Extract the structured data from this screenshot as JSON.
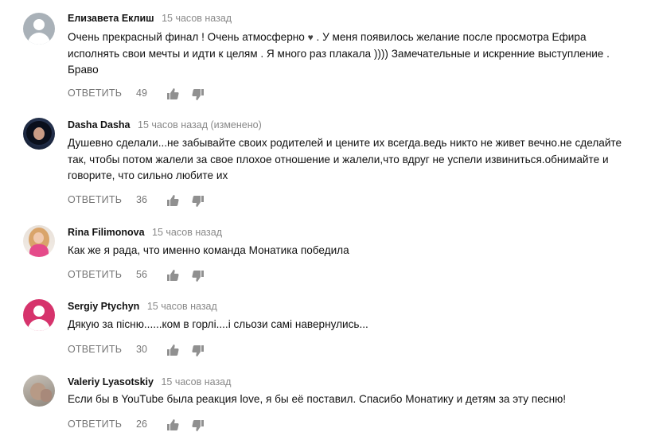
{
  "comments": [
    {
      "author": "Елизавета Еклиш",
      "time": "15 часов назад",
      "text_part1": "Очень прекрасный финал ! Очень атмосферно ",
      "emoji": "♥︎",
      "text_part2": " . У меня появилось желание после просмотра Ефира исполнять свои мечты и идти к целям . Я много раз плакала )))) Замечательные и искренние выступление . Браво",
      "likes": "49",
      "reply_label": "ОТВЕТИТЬ",
      "avatar": "default-avatar-grey"
    },
    {
      "author": "Dasha Dasha",
      "time": "15 часов назад (изменено)",
      "text": "Душевно сделали...не забывайте своих родителей и цените их всегда.ведь никто не живет вечно.не сделайте так, чтобы потом жалели за свое плохое отношение и жалели,что вдруг не успели извиниться.обнимайте и говорите, что сильно любите их",
      "likes": "36",
      "reply_label": "ОТВЕТИТЬ",
      "avatar": "photo"
    },
    {
      "author": "Rina Filimonova",
      "time": "15 часов назад",
      "text": "Как же я рада, что именно команда Монатика победила",
      "likes": "56",
      "reply_label": "ОТВЕТИТЬ",
      "avatar": "photo"
    },
    {
      "author": "Sergiy Ptychyn",
      "time": "15 часов назад",
      "text": "Дякую за пісню......ком в горлі....і сльози самі навернулись...",
      "likes": "30",
      "reply_label": "ОТВЕТИТЬ",
      "avatar": "default-avatar-pink"
    },
    {
      "author": "Valeriy Lyasotskiy",
      "time": "15 часов назад",
      "text": "Если бы в YouTube была реакция love, я бы её поставил. Спасибо Монатику и детям за эту песню!",
      "likes": "26",
      "reply_label": "ОТВЕТИТЬ",
      "avatar": "photo"
    }
  ],
  "icons": {
    "like": "thumbs-up-icon",
    "dislike": "thumbs-down-icon"
  },
  "colors": {
    "meta": "#888888",
    "actions": "#767676",
    "author": "#111111"
  }
}
